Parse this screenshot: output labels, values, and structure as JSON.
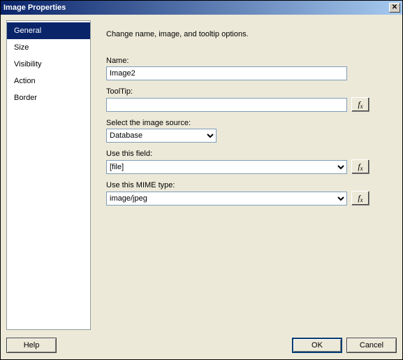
{
  "window": {
    "title": "Image Properties",
    "close_glyph": "✕"
  },
  "sidebar": {
    "items": [
      {
        "label": "General",
        "selected": true
      },
      {
        "label": "Size",
        "selected": false
      },
      {
        "label": "Visibility",
        "selected": false
      },
      {
        "label": "Action",
        "selected": false
      },
      {
        "label": "Border",
        "selected": false
      }
    ]
  },
  "content": {
    "heading": "Change name, image, and tooltip options.",
    "name_label": "Name:",
    "name_value": "Image2",
    "tooltip_label": "ToolTip:",
    "tooltip_value": "",
    "source_label": "Select the image source:",
    "source_value": "Database",
    "field_label": "Use this field:",
    "field_value": "[file]",
    "mime_label": "Use this MIME type:",
    "mime_value": "image/jpeg",
    "fx_label": "f",
    "fx_sub": "x"
  },
  "footer": {
    "help": "Help",
    "ok": "OK",
    "cancel": "Cancel"
  }
}
